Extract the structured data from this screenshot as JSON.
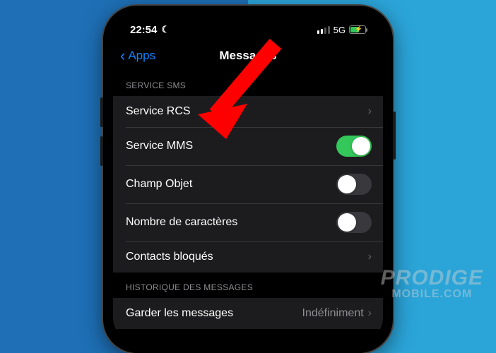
{
  "status": {
    "time": "22:54",
    "network": "5G"
  },
  "nav": {
    "back": "Apps",
    "title": "Messages"
  },
  "sections": {
    "sms_header": "SERVICE SMS",
    "rcs": "Service RCS",
    "mms": "Service MMS",
    "subject": "Champ Objet",
    "charcount": "Nombre de caractères",
    "blocked": "Contacts bloqués",
    "history_header": "HISTORIQUE DES MESSAGES",
    "keep_label": "Garder les messages",
    "keep_value": "Indéfiniment"
  },
  "watermark": {
    "line1": "PRODIGE",
    "line2": "MOBILE.COM"
  }
}
